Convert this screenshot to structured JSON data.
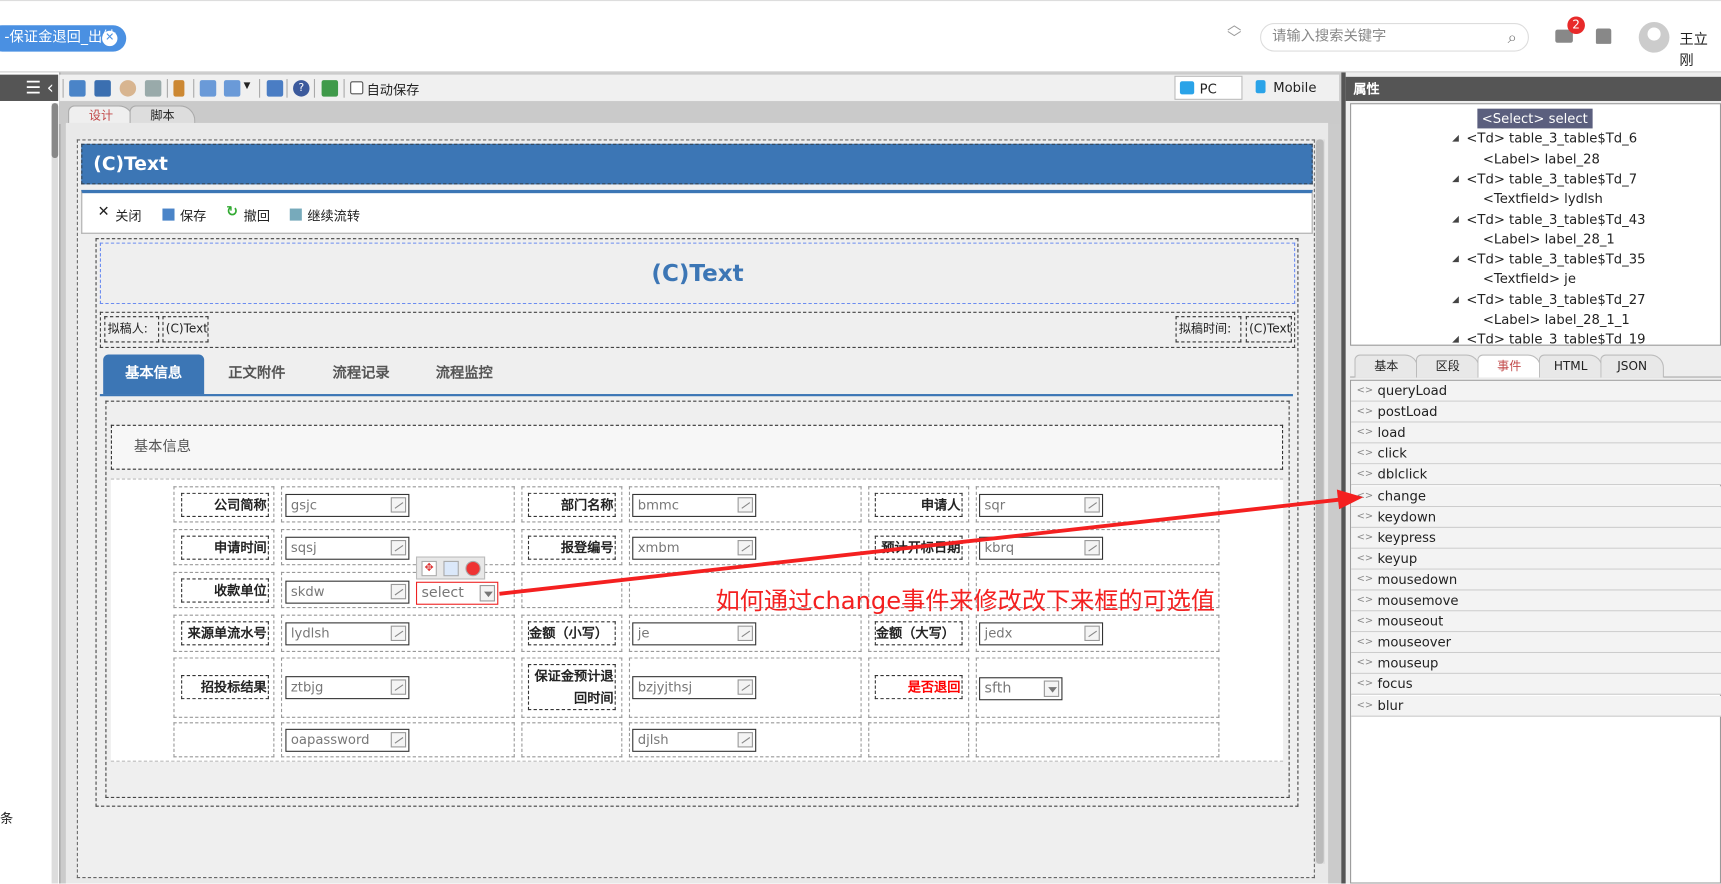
{
  "header": {
    "open_tab": "-保证金退回_出纳",
    "search_placeholder": "请输入搜索关键字",
    "notification_count": "2",
    "user_name": "王立刚"
  },
  "sidebar": {
    "partial_text": "条"
  },
  "toolbar": {
    "autosave_label": "自动保存",
    "device_pc": "PC",
    "device_mobile": "Mobile"
  },
  "designer_tabs": [
    "设计",
    "脚本"
  ],
  "form": {
    "header_title": "(C)Text",
    "actions": [
      "关闭",
      "保存",
      "撤回",
      "继续流转"
    ],
    "title": "(C)Text",
    "drafter_label": "拟稿人:",
    "drafter_value": "(C)Text",
    "draft_time_label": "拟稿时间:",
    "draft_time_value": "(C)Text",
    "tabs": [
      "基本信息",
      "正文附件",
      "流程记录",
      "流程监控"
    ],
    "section_title": "基本信息",
    "fields": {
      "gsjc_label": "公司简称",
      "gsjc": "gsjc",
      "bmmc_label": "部门名称",
      "bmmc": "bmmc",
      "sqr_label": "申请人",
      "sqr": "sqr",
      "sqsj_label": "申请时间",
      "sqsj": "sqsj",
      "xmbm_label": "报登编号",
      "xmbm": "xmbm",
      "kbrq_label": "预计开标日期",
      "kbrq": "kbrq",
      "skdw_label": "收款单位",
      "skdw": "skdw",
      "select": "select",
      "lydlsh_label": "来源单流水号",
      "lydlsh": "lydlsh",
      "je_label": "金额（小写）",
      "je": "je",
      "jedx_label": "金额（大写）",
      "jedx": "jedx",
      "ztbjg_label": "招投标结果",
      "ztbjg": "ztbjg",
      "bzjyjthsj_label_1": "保证金预计退",
      "bzjyjthsj_label_2": "回时间",
      "bzjyjthsj": "bzjyjthsj",
      "sfth_label": "是否退回",
      "sfth": "sfth",
      "oapassword": "oapassword",
      "djlsh": "djlsh"
    }
  },
  "annotation": {
    "text": "如何通过change事件来修改改下来框的可选值",
    "color": "#f42020"
  },
  "properties": {
    "title": "属性",
    "tree": [
      {
        "text": "<Select> select",
        "selected": true,
        "level": 2
      },
      {
        "text": "<Td> table_3_table$Td_6",
        "level": 1
      },
      {
        "text": "<Label> label_28",
        "level": 2
      },
      {
        "text": "<Td> table_3_table$Td_7",
        "level": 1
      },
      {
        "text": "<Textfield> lydlsh",
        "level": 2
      },
      {
        "text": "<Td> table_3_table$Td_43",
        "level": 1
      },
      {
        "text": "<Label> label_28_1",
        "level": 2
      },
      {
        "text": "<Td> table_3_table$Td_35",
        "level": 1
      },
      {
        "text": "<Textfield> je",
        "level": 2
      },
      {
        "text": "<Td> table_3_table$Td_27",
        "level": 1
      },
      {
        "text": "<Label> label_28_1_1",
        "level": 2
      },
      {
        "text": "<Td> table_3_table$Td_19",
        "level": 1
      }
    ],
    "tabs": [
      "基本",
      "区段",
      "事件",
      "HTML",
      "JSON"
    ],
    "active_tab": "事件",
    "events": [
      "queryLoad",
      "postLoad",
      "load",
      "click",
      "dblclick",
      "change",
      "keydown",
      "keypress",
      "keyup",
      "mousedown",
      "mousemove",
      "mouseout",
      "mouseover",
      "mouseup",
      "focus",
      "blur"
    ]
  },
  "colors": {
    "accent": "#3c76b5",
    "tab_pill": "#4a90e2",
    "panel_header": "#555555"
  }
}
